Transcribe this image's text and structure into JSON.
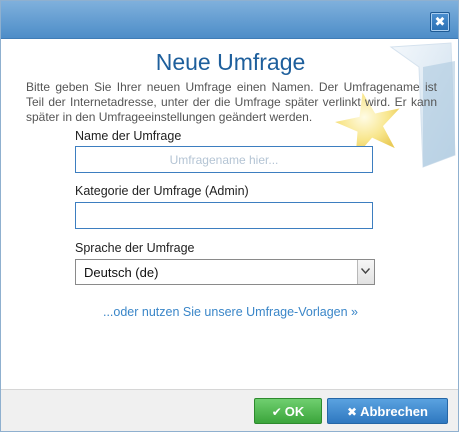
{
  "dialog": {
    "close_glyph": "✖",
    "title": "Neue Umfrage",
    "intro": "Bitte geben Sie Ihrer neuen Umfrage einen Namen. Der Umfragename ist Teil der Internetadresse, unter der die Umfrage später verlinkt wird. Er kann später in den Umfrageeinstellungen geändert werden."
  },
  "form": {
    "name_label": "Name der Umfrage",
    "name_placeholder": "Umfragename hier...",
    "name_value": "",
    "category_label": "Kategorie der Umfrage (Admin)",
    "category_value": "",
    "language_label": "Sprache der Umfrage",
    "language_selected": "Deutsch (de)"
  },
  "templates_link": "...oder nutzen Sie unsere Umfrage-Vorlagen »",
  "footer": {
    "ok_icon": "✔",
    "ok_label": "OK",
    "cancel_icon": "✖",
    "cancel_label": "Abbrechen"
  },
  "icons": {
    "close": "close-icon",
    "decoration": "folder-star-icon",
    "dropdown": "chevron-down-icon",
    "ok": "check-icon",
    "cancel": "x-icon"
  },
  "colors": {
    "titlebar": "#4d8dc8",
    "title_text": "#1e5f9c",
    "link": "#3a86c8",
    "ok_button": "#3ba53b",
    "cancel_button": "#2f78c0"
  }
}
